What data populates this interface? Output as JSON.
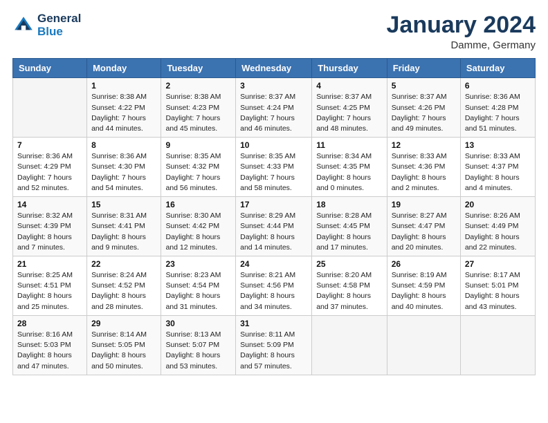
{
  "header": {
    "logo_line1": "General",
    "logo_line2": "Blue",
    "title": "January 2024",
    "subtitle": "Damme, Germany"
  },
  "weekdays": [
    "Sunday",
    "Monday",
    "Tuesday",
    "Wednesday",
    "Thursday",
    "Friday",
    "Saturday"
  ],
  "weeks": [
    [
      {
        "day": "",
        "info": ""
      },
      {
        "day": "1",
        "info": "Sunrise: 8:38 AM\nSunset: 4:22 PM\nDaylight: 7 hours\nand 44 minutes."
      },
      {
        "day": "2",
        "info": "Sunrise: 8:38 AM\nSunset: 4:23 PM\nDaylight: 7 hours\nand 45 minutes."
      },
      {
        "day": "3",
        "info": "Sunrise: 8:37 AM\nSunset: 4:24 PM\nDaylight: 7 hours\nand 46 minutes."
      },
      {
        "day": "4",
        "info": "Sunrise: 8:37 AM\nSunset: 4:25 PM\nDaylight: 7 hours\nand 48 minutes."
      },
      {
        "day": "5",
        "info": "Sunrise: 8:37 AM\nSunset: 4:26 PM\nDaylight: 7 hours\nand 49 minutes."
      },
      {
        "day": "6",
        "info": "Sunrise: 8:36 AM\nSunset: 4:28 PM\nDaylight: 7 hours\nand 51 minutes."
      }
    ],
    [
      {
        "day": "7",
        "info": "Sunrise: 8:36 AM\nSunset: 4:29 PM\nDaylight: 7 hours\nand 52 minutes."
      },
      {
        "day": "8",
        "info": "Sunrise: 8:36 AM\nSunset: 4:30 PM\nDaylight: 7 hours\nand 54 minutes."
      },
      {
        "day": "9",
        "info": "Sunrise: 8:35 AM\nSunset: 4:32 PM\nDaylight: 7 hours\nand 56 minutes."
      },
      {
        "day": "10",
        "info": "Sunrise: 8:35 AM\nSunset: 4:33 PM\nDaylight: 7 hours\nand 58 minutes."
      },
      {
        "day": "11",
        "info": "Sunrise: 8:34 AM\nSunset: 4:35 PM\nDaylight: 8 hours\nand 0 minutes."
      },
      {
        "day": "12",
        "info": "Sunrise: 8:33 AM\nSunset: 4:36 PM\nDaylight: 8 hours\nand 2 minutes."
      },
      {
        "day": "13",
        "info": "Sunrise: 8:33 AM\nSunset: 4:37 PM\nDaylight: 8 hours\nand 4 minutes."
      }
    ],
    [
      {
        "day": "14",
        "info": "Sunrise: 8:32 AM\nSunset: 4:39 PM\nDaylight: 8 hours\nand 7 minutes."
      },
      {
        "day": "15",
        "info": "Sunrise: 8:31 AM\nSunset: 4:41 PM\nDaylight: 8 hours\nand 9 minutes."
      },
      {
        "day": "16",
        "info": "Sunrise: 8:30 AM\nSunset: 4:42 PM\nDaylight: 8 hours\nand 12 minutes."
      },
      {
        "day": "17",
        "info": "Sunrise: 8:29 AM\nSunset: 4:44 PM\nDaylight: 8 hours\nand 14 minutes."
      },
      {
        "day": "18",
        "info": "Sunrise: 8:28 AM\nSunset: 4:45 PM\nDaylight: 8 hours\nand 17 minutes."
      },
      {
        "day": "19",
        "info": "Sunrise: 8:27 AM\nSunset: 4:47 PM\nDaylight: 8 hours\nand 20 minutes."
      },
      {
        "day": "20",
        "info": "Sunrise: 8:26 AM\nSunset: 4:49 PM\nDaylight: 8 hours\nand 22 minutes."
      }
    ],
    [
      {
        "day": "21",
        "info": "Sunrise: 8:25 AM\nSunset: 4:51 PM\nDaylight: 8 hours\nand 25 minutes."
      },
      {
        "day": "22",
        "info": "Sunrise: 8:24 AM\nSunset: 4:52 PM\nDaylight: 8 hours\nand 28 minutes."
      },
      {
        "day": "23",
        "info": "Sunrise: 8:23 AM\nSunset: 4:54 PM\nDaylight: 8 hours\nand 31 minutes."
      },
      {
        "day": "24",
        "info": "Sunrise: 8:21 AM\nSunset: 4:56 PM\nDaylight: 8 hours\nand 34 minutes."
      },
      {
        "day": "25",
        "info": "Sunrise: 8:20 AM\nSunset: 4:58 PM\nDaylight: 8 hours\nand 37 minutes."
      },
      {
        "day": "26",
        "info": "Sunrise: 8:19 AM\nSunset: 4:59 PM\nDaylight: 8 hours\nand 40 minutes."
      },
      {
        "day": "27",
        "info": "Sunrise: 8:17 AM\nSunset: 5:01 PM\nDaylight: 8 hours\nand 43 minutes."
      }
    ],
    [
      {
        "day": "28",
        "info": "Sunrise: 8:16 AM\nSunset: 5:03 PM\nDaylight: 8 hours\nand 47 minutes."
      },
      {
        "day": "29",
        "info": "Sunrise: 8:14 AM\nSunset: 5:05 PM\nDaylight: 8 hours\nand 50 minutes."
      },
      {
        "day": "30",
        "info": "Sunrise: 8:13 AM\nSunset: 5:07 PM\nDaylight: 8 hours\nand 53 minutes."
      },
      {
        "day": "31",
        "info": "Sunrise: 8:11 AM\nSunset: 5:09 PM\nDaylight: 8 hours\nand 57 minutes."
      },
      {
        "day": "",
        "info": ""
      },
      {
        "day": "",
        "info": ""
      },
      {
        "day": "",
        "info": ""
      }
    ]
  ]
}
